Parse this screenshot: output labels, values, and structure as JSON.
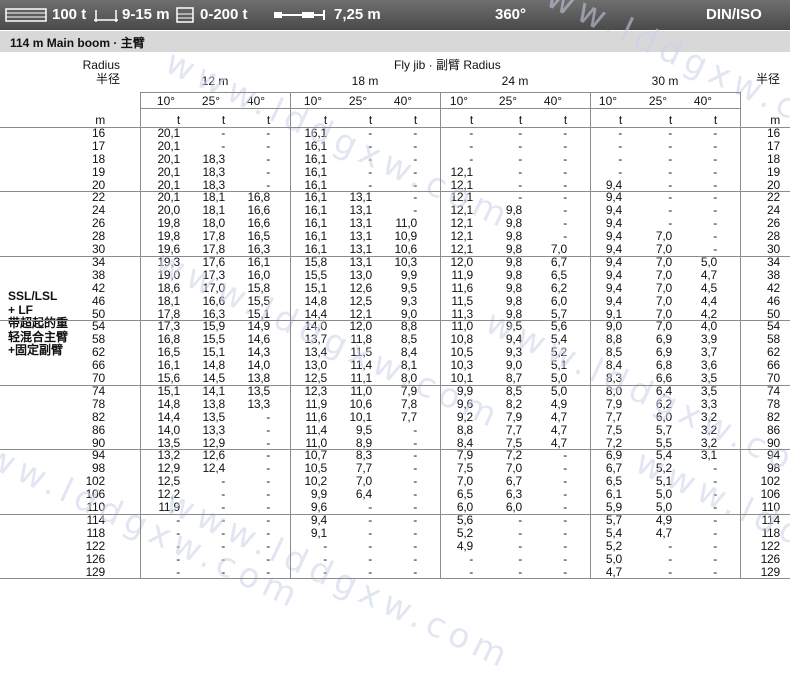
{
  "topbar": {
    "capacity": "100 t",
    "boom_length": "9-15 m",
    "counterweight": "0-200 t",
    "width": "7,25 m",
    "slew": "360°",
    "standard": "DIN/ISO"
  },
  "subheader": {
    "boom": "114 m   Main boom · 主臂"
  },
  "header": {
    "radius_en": "Radius",
    "radius_cn": "半径",
    "radius_cn_right": "半径",
    "fly_jib": "Fly jib ·  副臂 Radius",
    "jib_lengths": [
      "12 m",
      "18 m",
      "24 m",
      "30 m"
    ],
    "angles": [
      "10°",
      "25°",
      "40°",
      "10°",
      "25°",
      "40°",
      "10°",
      "25°",
      "40°",
      "10°",
      "25°",
      "40°"
    ],
    "unit_radius": "m",
    "unit_load": "t",
    "unit_radius_right": "m"
  },
  "side_label": "SSL/LSL\n+ LF\n带超起的重\n轻混合主臂\n+固定副臂",
  "watermark": "www.lddgxw.com",
  "chart_data": {
    "type": "table",
    "columns": [
      "Radius (m)",
      "12m 10°",
      "12m 25°",
      "12m 40°",
      "18m 10°",
      "18m 25°",
      "18m 40°",
      "24m 10°",
      "24m 25°",
      "24m 40°",
      "30m 10°",
      "30m 25°",
      "30m 40°",
      "Radius (m)"
    ],
    "rows": [
      [
        "16",
        "20,1",
        "-",
        "-",
        "16,1",
        "-",
        "-",
        "-",
        "-",
        "-",
        "-",
        "-",
        "-",
        "16"
      ],
      [
        "17",
        "20,1",
        "-",
        "-",
        "16,1",
        "-",
        "-",
        "-",
        "-",
        "-",
        "-",
        "-",
        "-",
        "17"
      ],
      [
        "18",
        "20,1",
        "18,3",
        "-",
        "16,1",
        "-",
        "-",
        "-",
        "-",
        "-",
        "-",
        "-",
        "-",
        "18"
      ],
      [
        "19",
        "20,1",
        "18,3",
        "-",
        "16,1",
        "-",
        "-",
        "12,1",
        "-",
        "-",
        "-",
        "-",
        "-",
        "19"
      ],
      [
        "20",
        "20,1",
        "18,3",
        "-",
        "16,1",
        "-",
        "-",
        "12,1",
        "-",
        "-",
        "9,4",
        "-",
        "-",
        "20"
      ],
      [
        "22",
        "20,1",
        "18,1",
        "16,8",
        "16,1",
        "13,1",
        "-",
        "12,1",
        "-",
        "-",
        "9,4",
        "-",
        "-",
        "22"
      ],
      [
        "24",
        "20,0",
        "18,1",
        "16,6",
        "16,1",
        "13,1",
        "-",
        "12,1",
        "9,8",
        "-",
        "9,4",
        "-",
        "-",
        "24"
      ],
      [
        "26",
        "19,8",
        "18,0",
        "16,6",
        "16,1",
        "13,1",
        "11,0",
        "12,1",
        "9,8",
        "-",
        "9,4",
        "-",
        "-",
        "26"
      ],
      [
        "28",
        "19,8",
        "17,8",
        "16,5",
        "16,1",
        "13,1",
        "10,9",
        "12,1",
        "9,8",
        "-",
        "9,4",
        "7,0",
        "-",
        "28"
      ],
      [
        "30",
        "19,6",
        "17,8",
        "16,3",
        "16,1",
        "13,1",
        "10,6",
        "12,1",
        "9,8",
        "7,0",
        "9,4",
        "7,0",
        "-",
        "30"
      ],
      [
        "34",
        "19,3",
        "17,6",
        "16,1",
        "15,8",
        "13,1",
        "10,3",
        "12,0",
        "9,8",
        "6,7",
        "9,4",
        "7,0",
        "5,0",
        "34"
      ],
      [
        "38",
        "19,0",
        "17,3",
        "16,0",
        "15,5",
        "13,0",
        "9,9",
        "11,9",
        "9,8",
        "6,5",
        "9,4",
        "7,0",
        "4,7",
        "38"
      ],
      [
        "42",
        "18,6",
        "17,0",
        "15,8",
        "15,1",
        "12,6",
        "9,5",
        "11,6",
        "9,8",
        "6,2",
        "9,4",
        "7,0",
        "4,5",
        "42"
      ],
      [
        "46",
        "18,1",
        "16,6",
        "15,5",
        "14,8",
        "12,5",
        "9,3",
        "11,5",
        "9,8",
        "6,0",
        "9,4",
        "7,0",
        "4,4",
        "46"
      ],
      [
        "50",
        "17,8",
        "16,3",
        "15,1",
        "14,4",
        "12,1",
        "9,0",
        "11,3",
        "9,8",
        "5,7",
        "9,1",
        "7,0",
        "4,2",
        "50"
      ],
      [
        "54",
        "17,3",
        "15,9",
        "14,9",
        "14,0",
        "12,0",
        "8,8",
        "11,0",
        "9,5",
        "5,6",
        "9,0",
        "7,0",
        "4,0",
        "54"
      ],
      [
        "58",
        "16,8",
        "15,5",
        "14,6",
        "13,7",
        "11,8",
        "8,5",
        "10,8",
        "9,4",
        "5,4",
        "8,8",
        "6,9",
        "3,9",
        "58"
      ],
      [
        "62",
        "16,5",
        "15,1",
        "14,3",
        "13,4",
        "11,5",
        "8,4",
        "10,5",
        "9,3",
        "5,2",
        "8,5",
        "6,9",
        "3,7",
        "62"
      ],
      [
        "66",
        "16,1",
        "14,8",
        "14,0",
        "13,0",
        "11,4",
        "8,1",
        "10,3",
        "9,0",
        "5,1",
        "8,4",
        "6,8",
        "3,6",
        "66"
      ],
      [
        "70",
        "15,6",
        "14,5",
        "13,8",
        "12,5",
        "11,1",
        "8,0",
        "10,1",
        "8,7",
        "5,0",
        "8,3",
        "6,6",
        "3,5",
        "70"
      ],
      [
        "74",
        "15,1",
        "14,1",
        "13,5",
        "12,3",
        "11,0",
        "7,9",
        "9,9",
        "8,5",
        "5,0",
        "8,0",
        "6,4",
        "3,5",
        "74"
      ],
      [
        "78",
        "14,8",
        "13,8",
        "13,3",
        "11,9",
        "10,6",
        "7,8",
        "9,6",
        "8,2",
        "4,9",
        "7,9",
        "6,2",
        "3,3",
        "78"
      ],
      [
        "82",
        "14,4",
        "13,5",
        "-",
        "11,6",
        "10,1",
        "7,7",
        "9,2",
        "7,9",
        "4,7",
        "7,7",
        "6,0",
        "3,2",
        "82"
      ],
      [
        "86",
        "14,0",
        "13,3",
        "-",
        "11,4",
        "9,5",
        "-",
        "8,8",
        "7,7",
        "4,7",
        "7,5",
        "5,7",
        "3,2",
        "86"
      ],
      [
        "90",
        "13,5",
        "12,9",
        "-",
        "11,0",
        "8,9",
        "-",
        "8,4",
        "7,5",
        "4,7",
        "7,2",
        "5,5",
        "3,2",
        "90"
      ],
      [
        "94",
        "13,2",
        "12,6",
        "-",
        "10,7",
        "8,3",
        "-",
        "7,9",
        "7,2",
        "-",
        "6,9",
        "5,4",
        "3,1",
        "94"
      ],
      [
        "98",
        "12,9",
        "12,4",
        "-",
        "10,5",
        "7,7",
        "-",
        "7,5",
        "7,0",
        "-",
        "6,7",
        "5,2",
        "-",
        "98"
      ],
      [
        "102",
        "12,5",
        "-",
        "-",
        "10,2",
        "7,0",
        "-",
        "7,0",
        "6,7",
        "-",
        "6,5",
        "5,1",
        "-",
        "102"
      ],
      [
        "106",
        "12,2",
        "-",
        "-",
        "9,9",
        "6,4",
        "-",
        "6,5",
        "6,3",
        "-",
        "6,1",
        "5,0",
        "-",
        "106"
      ],
      [
        "110",
        "11,9",
        "-",
        "-",
        "9,6",
        "-",
        "-",
        "6,0",
        "6,0",
        "-",
        "5,9",
        "5,0",
        "-",
        "110"
      ],
      [
        "114",
        "-",
        "-",
        "-",
        "9,4",
        "-",
        "-",
        "5,6",
        "-",
        "-",
        "5,7",
        "4,9",
        "-",
        "114"
      ],
      [
        "118",
        "-",
        "-",
        "-",
        "9,1",
        "-",
        "-",
        "5,2",
        "-",
        "-",
        "5,4",
        "4,7",
        "-",
        "118"
      ],
      [
        "122",
        "-",
        "-",
        "-",
        "-",
        "-",
        "-",
        "4,9",
        "-",
        "-",
        "5,2",
        "-",
        "-",
        "122"
      ],
      [
        "126",
        "-",
        "-",
        "-",
        "-",
        "-",
        "-",
        "-",
        "-",
        "-",
        "5,0",
        "-",
        "-",
        "126"
      ],
      [
        "129",
        "-",
        "-",
        "-",
        "-",
        "-",
        "-",
        "-",
        "-",
        "-",
        "4,7",
        "-",
        "-",
        "129"
      ]
    ]
  }
}
